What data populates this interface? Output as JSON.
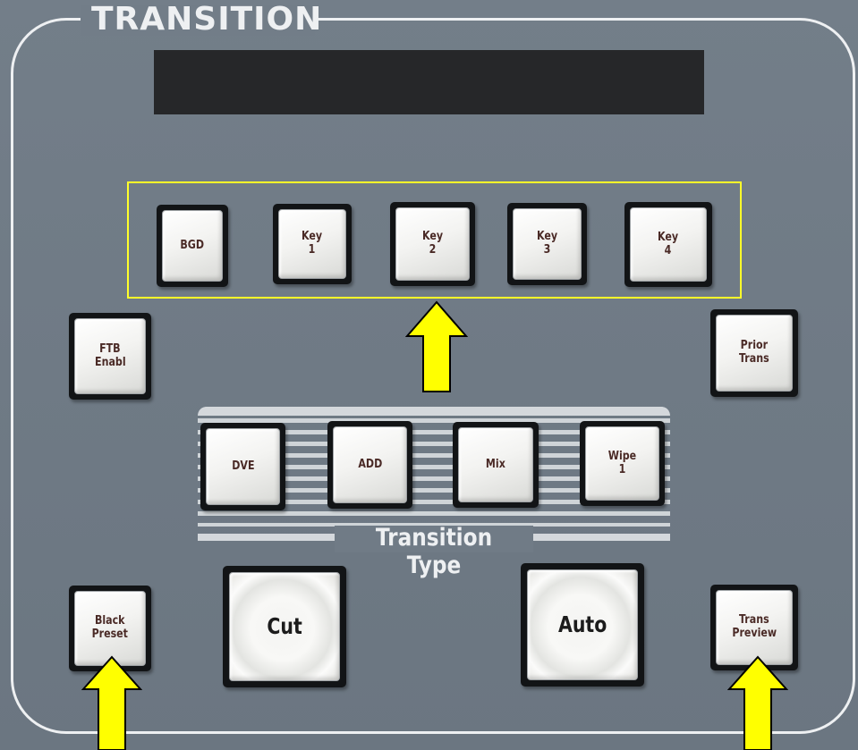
{
  "panel": {
    "title": "TRANSITION",
    "transition_type_label": "Transition Type"
  },
  "key_buttons": [
    {
      "label_line1": "BGD",
      "label_line2": ""
    },
    {
      "label_line1": "Key",
      "label_line2": "1"
    },
    {
      "label_line1": "Key",
      "label_line2": "2"
    },
    {
      "label_line1": "Key",
      "label_line2": "3"
    },
    {
      "label_line1": "Key",
      "label_line2": "4"
    }
  ],
  "side_buttons": {
    "ftb": {
      "label_line1": "FTB",
      "label_line2": "Enabl"
    },
    "prior": {
      "label_line1": "Prior",
      "label_line2": "Trans"
    }
  },
  "type_buttons": [
    {
      "label_line1": "DVE",
      "label_line2": ""
    },
    {
      "label_line1": "ADD",
      "label_line2": ""
    },
    {
      "label_line1": "Mix",
      "label_line2": ""
    },
    {
      "label_line1": "Wipe",
      "label_line2": "1"
    }
  ],
  "bottom_buttons": {
    "black_preset": {
      "label_line1": "Black",
      "label_line2": "Preset"
    },
    "cut": {
      "label": "Cut"
    },
    "auto": {
      "label": "Auto"
    },
    "trans_preview": {
      "label_line1": "Trans",
      "label_line2": "Preview"
    }
  },
  "colors": {
    "panel": "#727d88",
    "highlight": "#ffff2a",
    "arrow": "#ffff00",
    "button_cap": "#f3f3f1",
    "button_label": "#4a2a26"
  },
  "icons": [
    "arrow-up-icon"
  ]
}
